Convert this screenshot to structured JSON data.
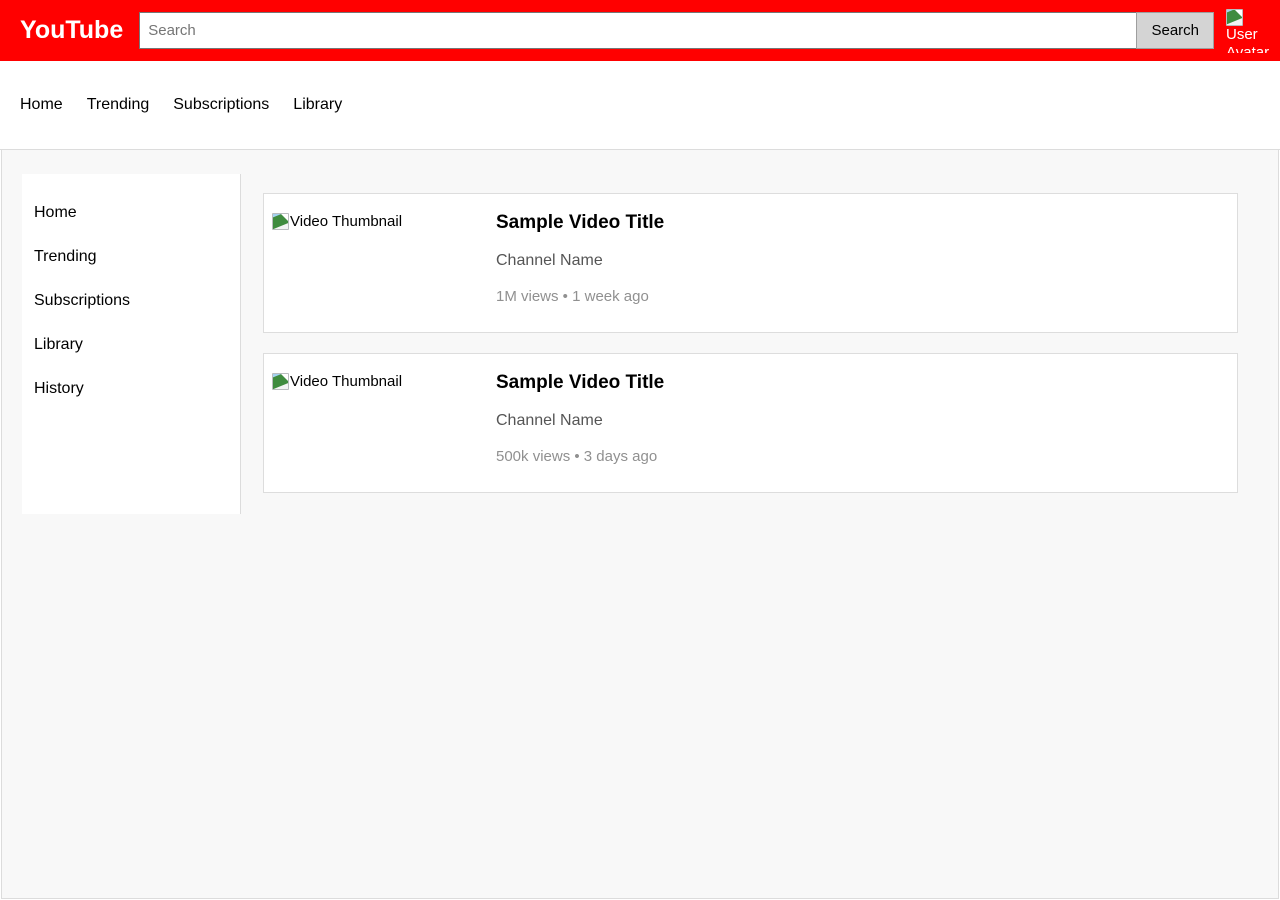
{
  "header": {
    "logo": "YouTube",
    "brand_color": "#ff0000",
    "search": {
      "placeholder": "Search",
      "value": "",
      "button_label": "Search"
    },
    "avatar": {
      "icon": "broken-image-icon",
      "alt_text": "User Avatar"
    }
  },
  "navbar": {
    "items": [
      {
        "label": "Home"
      },
      {
        "label": "Trending"
      },
      {
        "label": "Subscriptions"
      },
      {
        "label": "Library"
      }
    ]
  },
  "sidebar": {
    "items": [
      {
        "label": "Home"
      },
      {
        "label": "Trending"
      },
      {
        "label": "Subscriptions"
      },
      {
        "label": "Library"
      },
      {
        "label": "History"
      }
    ]
  },
  "main": {
    "videos": [
      {
        "thumbnail_alt": "Video Thumbnail",
        "title": "Sample Video Title",
        "channel": "Channel Name",
        "meta": "1M views • 1 week ago",
        "views": "1M views",
        "published": "1 week ago"
      },
      {
        "thumbnail_alt": "Video Thumbnail",
        "title": "Sample Video Title",
        "channel": "Channel Name",
        "meta": "500k views • 3 days ago",
        "views": "500k views",
        "published": "3 days ago"
      }
    ]
  }
}
